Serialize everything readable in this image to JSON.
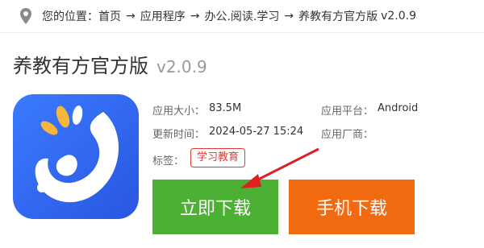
{
  "breadcrumb": {
    "location_label": "您的位置：",
    "items": [
      "首页",
      "应用程序",
      "办公.阅读.学习",
      "养教有方官方版"
    ],
    "separator": "→",
    "version": "v2.0.9"
  },
  "app": {
    "title": "养教有方官方版",
    "version": "v2.0.9",
    "size_label": "应用大小：",
    "size_value": "83.5M",
    "platform_label": "应用平台：",
    "platform_value": "Android",
    "updated_label": "更新时间：",
    "updated_value": "2024-05-27 15:24",
    "vendor_label": "应用厂商：",
    "vendor_value": "",
    "tag_label": "标签：",
    "tags": [
      "学习教育"
    ]
  },
  "buttons": {
    "download": "立即下载",
    "mobile_download": "手机下载"
  },
  "colors": {
    "download_green": "#4cb034",
    "mobile_orange": "#f26a0f",
    "tag_red": "#e53935",
    "icon_blue": "#2f6df0"
  }
}
